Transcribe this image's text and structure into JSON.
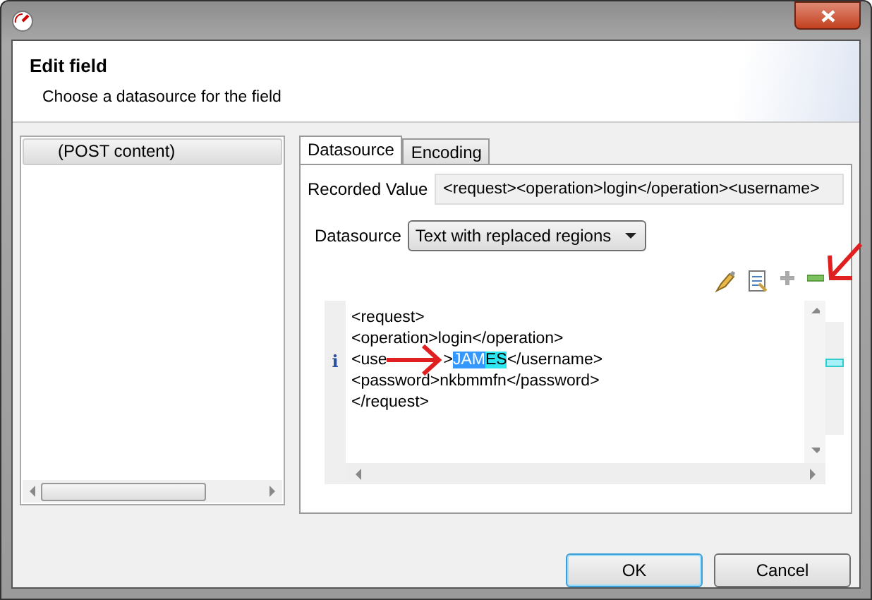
{
  "header": {
    "title": "Edit field",
    "subtitle": "Choose a datasource for the field"
  },
  "fields": {
    "items": [
      {
        "label": "(POST content)",
        "selected": true
      }
    ]
  },
  "tabs": [
    {
      "label": "Datasource",
      "selected": true
    },
    {
      "label": "Encoding",
      "selected": false
    }
  ],
  "recorded_value": {
    "label": "Recorded Value",
    "value": "<request><operation>login</operation><username>"
  },
  "datasource": {
    "label": "Datasource",
    "value": "Text with replaced regions"
  },
  "editor": {
    "lines": [
      {
        "segments": [
          {
            "kind": "plain",
            "text": "<request>"
          }
        ]
      },
      {
        "segments": [
          {
            "kind": "plain",
            "text": "<operation>login</operation>"
          }
        ]
      },
      {
        "marker": "i",
        "segments": [
          {
            "kind": "plain",
            "text": "<use"
          },
          {
            "kind": "arrow"
          },
          {
            "kind": "plain",
            "text": ">"
          },
          {
            "kind": "selected",
            "text": "JAM"
          },
          {
            "kind": "region",
            "text": "ES"
          },
          {
            "kind": "plain",
            "text": "</username>"
          }
        ]
      },
      {
        "segments": [
          {
            "kind": "plain",
            "text": "<password>nkbmmfn</password>"
          }
        ]
      },
      {
        "segments": [
          {
            "kind": "plain",
            "text": "</request>"
          }
        ]
      }
    ]
  },
  "buttons": [
    {
      "label": "OK",
      "default": true
    },
    {
      "label": "Cancel",
      "default": false
    }
  ]
}
